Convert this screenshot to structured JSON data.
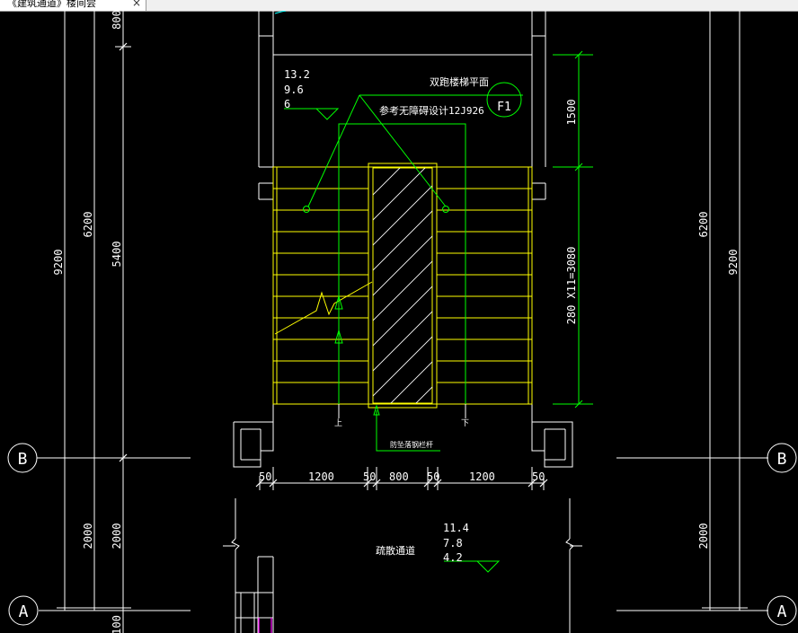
{
  "tab": {
    "label": "《建筑通道》楼间尝",
    "close": "×"
  },
  "drawing": {
    "title": "双跑楼梯平面",
    "section_mark": "F1",
    "reference": "参考无障碍设计12J926",
    "elevations_top": [
      "13.2",
      "9.6",
      "6"
    ],
    "elevations_bottom": [
      "11.4",
      "7.8",
      "4.2"
    ],
    "corridor_label": "疏散通道",
    "handrail_label": "防坠落钢栏杆",
    "up_label": "上",
    "down_label": "下",
    "grid_b": "B",
    "grid_a": "A",
    "dims": {
      "left_9200": "9200",
      "left_6200": "6200",
      "left_5400": "5400",
      "left_2000a": "2000",
      "left_2000b": "2000",
      "left_800": "800",
      "left_bottom": "100",
      "right_1500": "1500",
      "right_flight": "280 X11=3080",
      "right_6200": "6200",
      "right_9200": "9200",
      "right_2000": "2000",
      "h_50a": "50",
      "h_1200a": "1200",
      "h_50b": "50",
      "h_800": "800",
      "h_50c": "50",
      "h_1200b": "1200",
      "h_50d": "50"
    },
    "colors": {
      "white": "#ffffff",
      "yellow": "#ffff00",
      "green": "#00ff00",
      "magenta": "#ff00ff",
      "cyan": "#00ffff"
    }
  }
}
